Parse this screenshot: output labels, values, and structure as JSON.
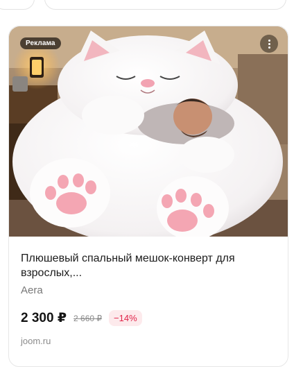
{
  "ad": {
    "badge": "Реклама",
    "title": "Плюшевый спальный мешок-конверт для взрослых,...",
    "brand": "Aera",
    "price": "2 300 ₽",
    "old_price": "2 660 ₽",
    "discount": "−14%",
    "store": "joom.ru",
    "image_icon": "more-options-icon"
  }
}
